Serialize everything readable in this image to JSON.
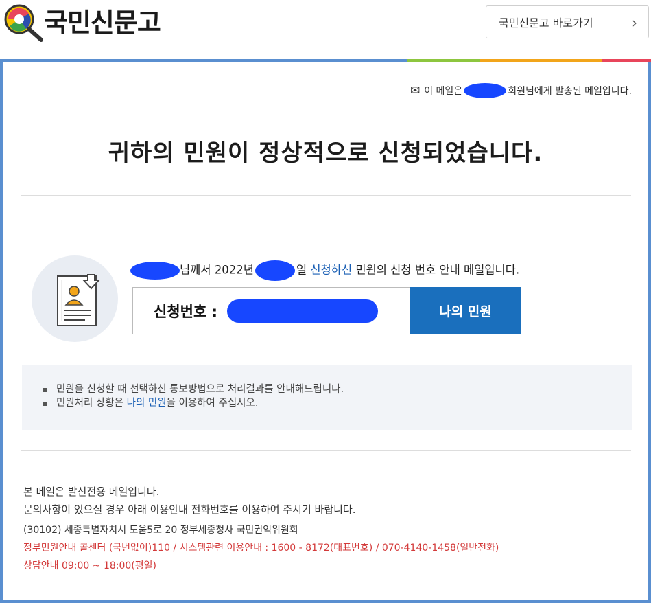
{
  "header": {
    "logo_text": "국민신문고",
    "shortcut_label": "국민신문고 바로가기",
    "chevron": "›"
  },
  "colors": {
    "frame_border": "#5a8fd0",
    "bar_blue": "#5a8fd0",
    "bar_green": "#8dc63f",
    "bar_orange": "#f2a51a",
    "bar_red": "#e8455b",
    "button_blue": "#1a6fbd",
    "link_blue": "#1a5fb4",
    "footer_red": "#d33a3a"
  },
  "mail": {
    "recipient_icon": "envelope-icon",
    "recipient_prefix": "이 메일은",
    "recipient_suffix": "회원님에게 발송된 메일입니다.",
    "title": "귀하의 민원이 정상적으로 신청되었습니다.",
    "intro_1": "님께서 2022년",
    "intro_2": "일",
    "intro_link": "신청하신",
    "intro_3": "민원의 신청 번호 안내 메일입니다.",
    "app_label": "신청번호 :",
    "my_button": "나의 민원"
  },
  "notice": {
    "line1": "민원을 신청할 때 선택하신 통보방법으로 처리결과를 안내해드립니다.",
    "line2_prefix": "민원처리 상황은",
    "line2_link": "나의 민원",
    "line2_suffix": "을 이용하여 주십시오."
  },
  "footer": {
    "line1": "본 메일은 발신전용 메일입니다.",
    "line2": "문의사항이 있으실 경우 아래 이용안내 전화번호를 이용하여 주시기 바랍니다.",
    "address": "(30102) 세종특별자치시 도움5로 20 정부세종청사 국민권익위원회",
    "call_center": "정부민원안내 콜센터 (국번없이)110 / 시스템관련 이용안내 : 1600 - 8172(대표번호) / 070-4140-1458(일반전화)",
    "hours": "상담안내 09:00 ~ 18:00(평일)"
  }
}
